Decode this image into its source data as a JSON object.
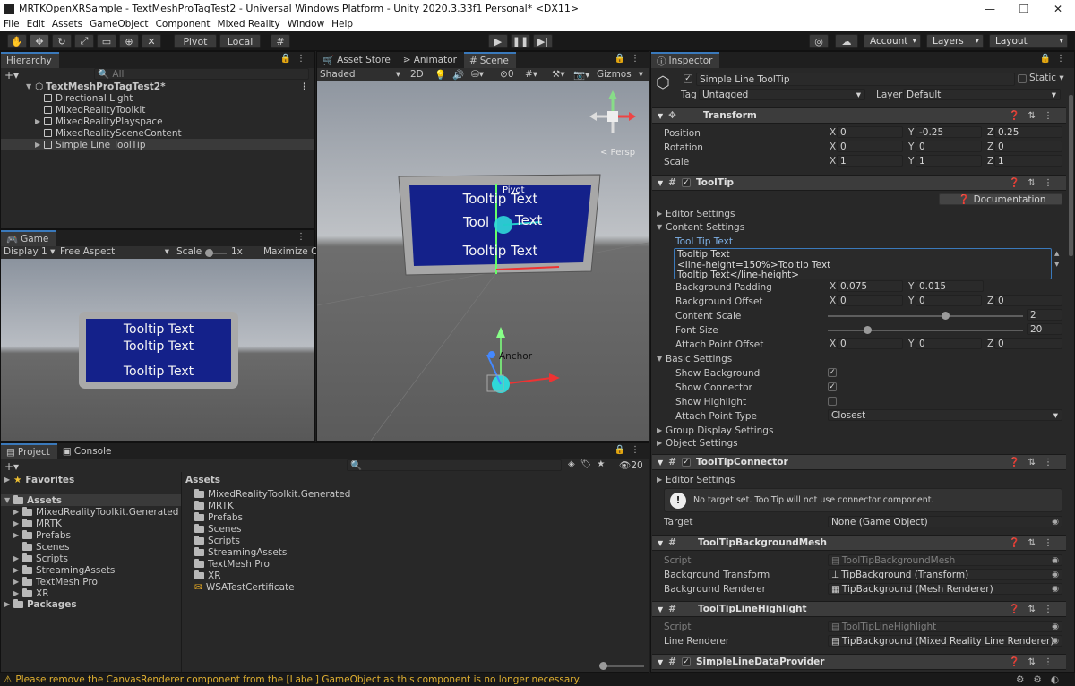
{
  "window": {
    "title": "MRTKOpenXRSample - TextMeshProTagTest2 - Universal Windows Platform - Unity 2020.3.33f1 Personal* <DX11>",
    "min": "—",
    "max": "❐",
    "close": "✕"
  },
  "menu": [
    "File",
    "Edit",
    "Assets",
    "GameObject",
    "Component",
    "Mixed Reality",
    "Window",
    "Help"
  ],
  "toolbar": {
    "pivot": "Pivot",
    "local": "Local",
    "account": "Account",
    "layers": "Layers",
    "layout": "Layout"
  },
  "hierarchy": {
    "tab": "Hierarchy",
    "search": "All",
    "scene": "TextMeshProTagTest2*",
    "items": [
      "Directional Light",
      "MixedRealityToolkit",
      "MixedRealityPlayspace",
      "MixedRealitySceneContent",
      "Simple Line ToolTip"
    ]
  },
  "game": {
    "tab": "Game",
    "display": "Display 1",
    "aspect": "Free Aspect",
    "scale_label": "Scale",
    "scale_value": "1x",
    "maximize": "Maximize On",
    "lines": [
      "Tooltip Text",
      "Tooltip Text",
      "Tooltip Text"
    ]
  },
  "scene": {
    "tabs": [
      "Asset Store",
      "Animator",
      "Scene"
    ],
    "shading": "Shaded",
    "mode2d": "2D",
    "gizmos": "Gizmos",
    "fx": "0",
    "lines": [
      "Tooltip Text",
      "Tool",
      "Text",
      "Tooltip Text"
    ],
    "pivot": "Pivot",
    "anchor": "Anchor",
    "persp": "< Persp"
  },
  "project": {
    "tabs": [
      "Project",
      "Console"
    ],
    "favorites": "Favorites",
    "assets": "Assets",
    "tree": [
      "MixedRealityToolkit.Generated",
      "MRTK",
      "Prefabs",
      "Scenes",
      "Scripts",
      "StreamingAssets",
      "TextMesh Pro",
      "XR"
    ],
    "packages": "Packages",
    "header": "Assets",
    "files": [
      "MixedRealityToolkit.Generated",
      "MRTK",
      "Prefabs",
      "Scenes",
      "Scripts",
      "StreamingAssets",
      "TextMesh Pro",
      "XR",
      "WSATestCertificate"
    ],
    "count": "20"
  },
  "status": {
    "message": "Please remove the CanvasRenderer component from the [Label] GameObject as this component is no longer necessary."
  },
  "inspector": {
    "tab": "Inspector",
    "name": "Simple Line ToolTip",
    "static": "Static",
    "tag_label": "Tag",
    "tag": "Untagged",
    "layer_label": "Layer",
    "layer": "Default",
    "transform": {
      "title": "Transform",
      "position_label": "Position",
      "rotation_label": "Rotation",
      "scale_label": "Scale",
      "position": [
        "0",
        "-0.25",
        "0.25"
      ],
      "rotation": [
        "0",
        "0",
        "0"
      ],
      "scale": [
        "1",
        "1",
        "1"
      ]
    },
    "axes": [
      "X",
      "Y",
      "Z"
    ],
    "tooltip": {
      "title": "ToolTip",
      "documentation": "Documentation",
      "editor_settings": "Editor Settings",
      "content_settings": "Content Settings",
      "tooltip_text_label": "Tool Tip Text",
      "text_lines": [
        "Tooltip Text",
        "<line-height=150%>Tooltip Text",
        "Tooltip Text</line-height>"
      ],
      "bg_padding_label": "Background Padding",
      "bg_padding": [
        "0.075",
        "0.015"
      ],
      "bg_offset_label": "Background Offset",
      "bg_offset": [
        "0",
        "0",
        "0"
      ],
      "content_scale_label": "Content Scale",
      "content_scale": "2",
      "content_scale_level": 0.6,
      "font_size_label": "Font Size",
      "font_size": "20",
      "font_size_level": 0.2,
      "attach_offset_label": "Attach Point Offset",
      "attach_offset": [
        "0",
        "0",
        "0"
      ],
      "basic_settings": "Basic Settings",
      "show_background": "Show Background",
      "show_connector": "Show Connector",
      "show_highlight": "Show Highlight",
      "attach_type_label": "Attach Point Type",
      "attach_type": "Closest",
      "group_display": "Group Display Settings",
      "object_settings": "Object Settings"
    },
    "connector": {
      "title": "ToolTipConnector",
      "editor_settings": "Editor Settings",
      "warning": "No target set. ToolTip will not use connector component.",
      "target_label": "Target",
      "target": "None (Game Object)"
    },
    "bgmesh": {
      "title": "ToolTipBackgroundMesh",
      "script_label": "Script",
      "script": "ToolTipBackgroundMesh",
      "bg_transform_label": "Background Transform",
      "bg_transform": "TipBackground (Transform)",
      "bg_renderer_label": "Background Renderer",
      "bg_renderer": "TipBackground (Mesh Renderer)"
    },
    "highlight": {
      "title": "ToolTipLineHighlight",
      "script_label": "Script",
      "script": "ToolTipLineHighlight",
      "line_renderer_label": "Line Renderer",
      "line_renderer": "TipBackground (Mixed Reality Line Renderer)"
    },
    "dataprovider": {
      "title": "SimpleLineDataProvider"
    }
  },
  "colors": {
    "accent": "#3a79bb",
    "tooltip_blue": "#14218a",
    "selection": "#2c5d87"
  }
}
